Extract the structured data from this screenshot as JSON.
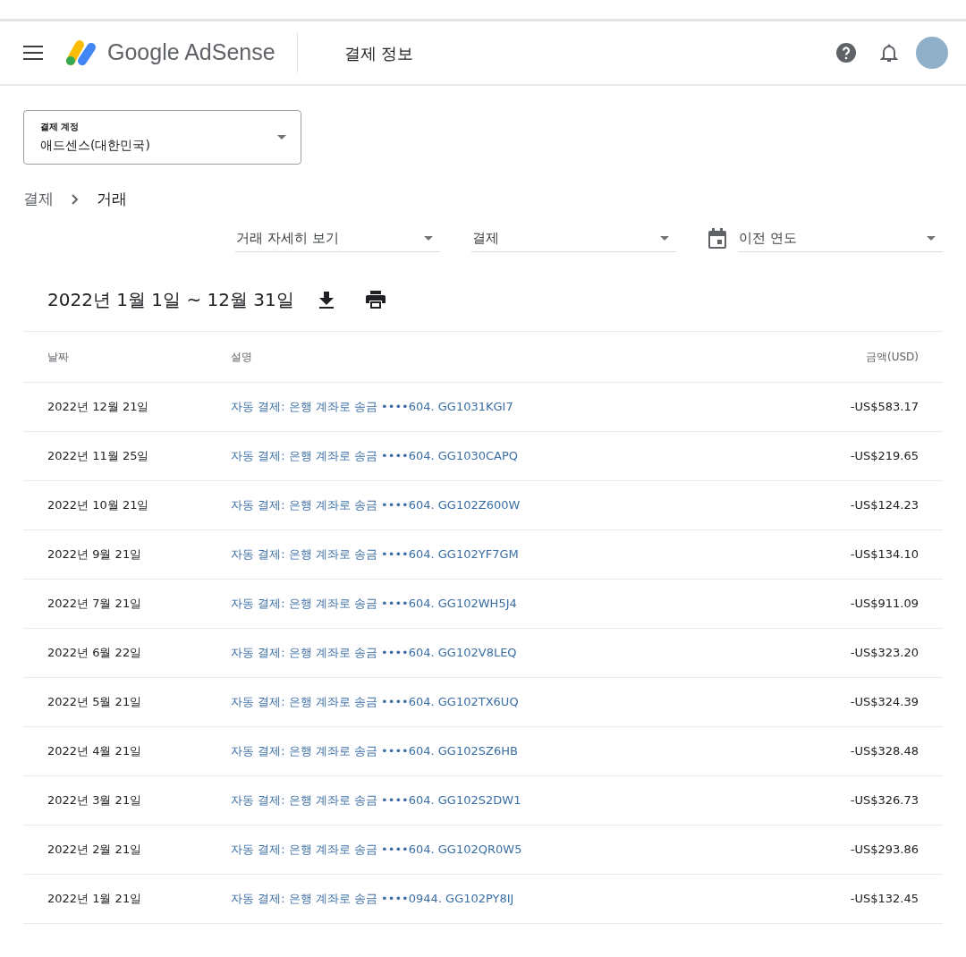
{
  "header": {
    "logo_text": "Google AdSense",
    "page_title": "결제 정보"
  },
  "account_select": {
    "label": "결제 계정",
    "value": "애드센스(대한민국)"
  },
  "breadcrumb": [
    "결제",
    "거래"
  ],
  "filters": [
    {
      "kind": "plain",
      "value": "거래 자세히 보기"
    },
    {
      "kind": "plain",
      "value": "결제"
    },
    {
      "kind": "date",
      "value": "이전 연도"
    }
  ],
  "period_title": "2022년 1월 1일 ~ 12월 31일",
  "table": {
    "columns": [
      "날짜",
      "설명",
      "금액(USD)"
    ],
    "rows": [
      {
        "date": "2022년 12월 21일",
        "description": "자동 결제: 은행 계좌로 송금 ••••604. GG1031KGI7",
        "amount": "-US$583.17"
      },
      {
        "date": "2022년 11월 25일",
        "description": "자동 결제: 은행 계좌로 송금 ••••604. GG1030CAPQ",
        "amount": "-US$219.65"
      },
      {
        "date": "2022년 10월 21일",
        "description": "자동 결제: 은행 계좌로 송금 ••••604. GG102Z600W",
        "amount": "-US$124.23"
      },
      {
        "date": "2022년 9월 21일",
        "description": "자동 결제: 은행 계좌로 송금 ••••604. GG102YF7GM",
        "amount": "-US$134.10"
      },
      {
        "date": "2022년 7월 21일",
        "description": "자동 결제: 은행 계좌로 송금 ••••604. GG102WH5J4",
        "amount": "-US$911.09"
      },
      {
        "date": "2022년 6월 22일",
        "description": "자동 결제: 은행 계좌로 송금 ••••604. GG102V8LEQ",
        "amount": "-US$323.20"
      },
      {
        "date": "2022년 5월 21일",
        "description": "자동 결제: 은행 계좌로 송금 ••••604. GG102TX6UQ",
        "amount": "-US$324.39"
      },
      {
        "date": "2022년 4월 21일",
        "description": "자동 결제: 은행 계좌로 송금 ••••604. GG102SZ6HB",
        "amount": "-US$328.48"
      },
      {
        "date": "2022년 3월 21일",
        "description": "자동 결제: 은행 계좌로 송금 ••••604. GG102S2DW1",
        "amount": "-US$326.73"
      },
      {
        "date": "2022년 2월 21일",
        "description": "자동 결제: 은행 계좌로 송금 ••••604. GG102QR0W5",
        "amount": "-US$293.86"
      },
      {
        "date": "2022년 1월 21일",
        "description": "자동 결제: 은행 계좌로 송금 ••••0944. GG102PY8IJ",
        "amount": "-US$132.45"
      }
    ]
  }
}
